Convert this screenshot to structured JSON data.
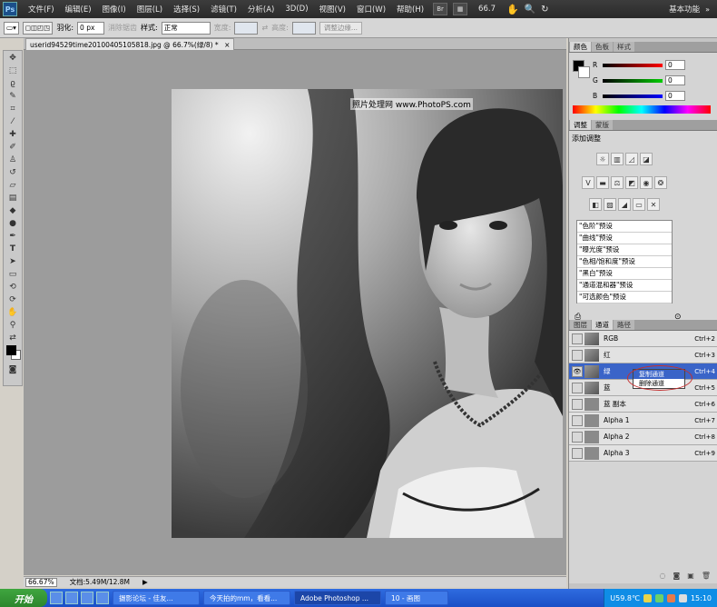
{
  "menubar": {
    "logo": "Ps",
    "items": [
      "文件(F)",
      "编辑(E)",
      "图像(I)",
      "图层(L)",
      "选择(S)",
      "滤镜(T)",
      "分析(A)",
      "3D(D)",
      "视图(V)",
      "窗口(W)",
      "帮助(H)"
    ],
    "zoom": "66.7",
    "workspace": "基本功能"
  },
  "options": {
    "feather_label": "羽化:",
    "feather_value": "0 px",
    "antialias_label": "消除锯齿",
    "style_label": "样式:",
    "style_value": "正常",
    "width_label": "宽度:",
    "height_label": "高度:",
    "refine_label": "调整边缘..."
  },
  "document": {
    "tab_title": "userid94529time20100405105818.jpg @ 66.7%(绿/8) *",
    "watermark": "照片处理网 www.PhotoPS.com"
  },
  "status": {
    "zoom": "66.67%",
    "doc_size": "文档:5.49M/12.8M"
  },
  "color_panel": {
    "tabs": [
      "颜色",
      "色板",
      "样式"
    ],
    "r_label": "R",
    "g_label": "G",
    "b_label": "B",
    "r": "0",
    "g": "0",
    "b": "0"
  },
  "adjust_panel": {
    "tabs": [
      "调整",
      "蒙版"
    ],
    "title": "添加调整",
    "presets": [
      "\"色阶\"预设",
      "\"曲线\"预设",
      "\"曝光度\"预设",
      "\"色相/饱和度\"预设",
      "\"黑白\"预设",
      "\"通道混和器\"预设",
      "\"可选颜色\"预设"
    ]
  },
  "channels_panel": {
    "tabs": [
      "图层",
      "通道",
      "路径"
    ],
    "channels": [
      {
        "name": "RGB",
        "shortcut": "Ctrl+2"
      },
      {
        "name": "红",
        "shortcut": "Ctrl+3"
      },
      {
        "name": "绿",
        "shortcut": "Ctrl+4"
      },
      {
        "name": "蓝",
        "shortcut": "Ctrl+5"
      },
      {
        "name": "蓝 副本",
        "shortcut": "Ctrl+6"
      },
      {
        "name": "Alpha 1",
        "shortcut": "Ctrl+7"
      },
      {
        "name": "Alpha 2",
        "shortcut": "Ctrl+8"
      },
      {
        "name": "Alpha 3",
        "shortcut": "Ctrl+9"
      }
    ],
    "context_menu": [
      "复制通道",
      "删除通道"
    ]
  },
  "taskbar": {
    "start": "开始",
    "tasks": [
      "摄影论坛 - 佳友...",
      "今天拍的mm，看看...",
      "Adobe Photoshop ...",
      "10 - 画图"
    ],
    "tray_text": "U59.8℃",
    "clock": "15:10"
  },
  "colors": {
    "accent": "#3a64c8",
    "taskbar": "#1b4fc6"
  }
}
